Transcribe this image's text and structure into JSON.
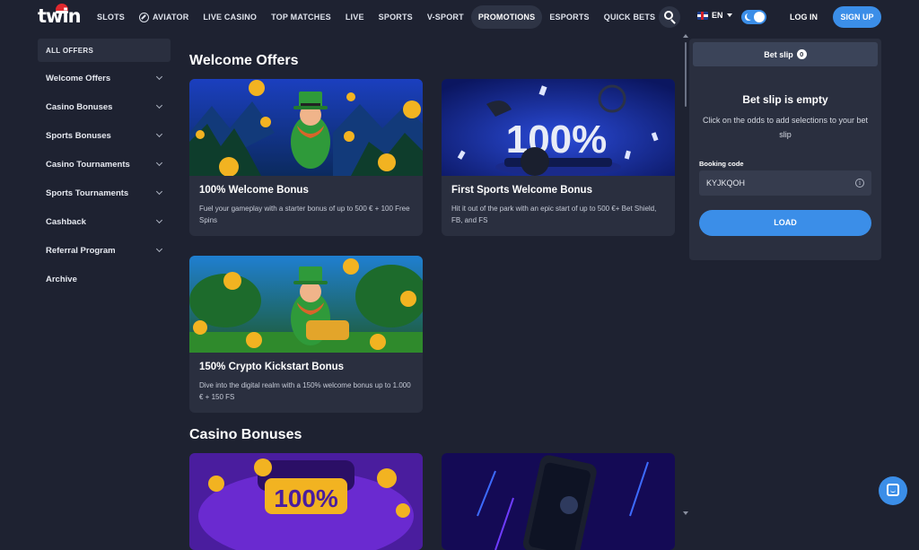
{
  "brand": {
    "logo_text": "twin"
  },
  "nav": {
    "items": [
      "SLOTS",
      "AVIATOR",
      "LIVE CASINO",
      "TOP MATCHES",
      "LIVE",
      "SPORTS",
      "V-SPORT",
      "PROMOTIONS",
      "ESPORTS",
      "QUICK BETS"
    ],
    "active": "PROMOTIONS"
  },
  "header": {
    "language": "EN",
    "login_label": "LOG IN",
    "signup_label": "SIGN UP"
  },
  "sidebar": {
    "header": "ALL OFFERS",
    "items": [
      {
        "label": "Welcome Offers",
        "expandable": true
      },
      {
        "label": "Casino Bonuses",
        "expandable": true
      },
      {
        "label": "Sports Bonuses",
        "expandable": true
      },
      {
        "label": "Casino Tournaments",
        "expandable": true
      },
      {
        "label": "Sports Tournaments",
        "expandable": true
      },
      {
        "label": "Cashback",
        "expandable": true
      },
      {
        "label": "Referral Program",
        "expandable": true
      },
      {
        "label": "Archive",
        "expandable": false
      }
    ]
  },
  "sections": [
    {
      "title": "Welcome Offers",
      "cards": [
        {
          "title": "100% Welcome Bonus",
          "desc": "Fuel your gameplay with a starter bonus of up to 500 € + 100 Free Spins",
          "img_label": ""
        },
        {
          "title": "First Sports Welcome Bonus",
          "desc": "Hit it out of the park with an epic start of up to 500 €+ Bet Shield, FB, and FS",
          "img_label": "100%"
        },
        {
          "title": "150% Crypto Kickstart Bonus",
          "desc": "Dive into the digital realm with a 150% welcome bonus up to 1.000 € + 150 FS",
          "img_label": ""
        }
      ]
    },
    {
      "title": "Casino Bonuses",
      "cards": [
        {
          "title": "",
          "desc": "",
          "img_label": "100%"
        },
        {
          "title": "",
          "desc": "",
          "img_label": ""
        }
      ]
    }
  ],
  "betslip": {
    "tab_label": "Bet slip",
    "count": "0",
    "empty_title": "Bet slip is empty",
    "hint": "Click on the odds to add selections to your bet slip",
    "booking_label": "Booking code",
    "booking_value": "KYJKQOH",
    "load_label": "LOAD"
  },
  "colors": {
    "accent": "#3b8ee8",
    "background": "#1e2231",
    "panel": "#2a2f3f"
  },
  "icons": [
    "search-icon",
    "flag-uk-icon",
    "theme-toggle-icon",
    "info-icon",
    "chat-icon",
    "aviator-icon",
    "chevron-down-icon"
  ]
}
